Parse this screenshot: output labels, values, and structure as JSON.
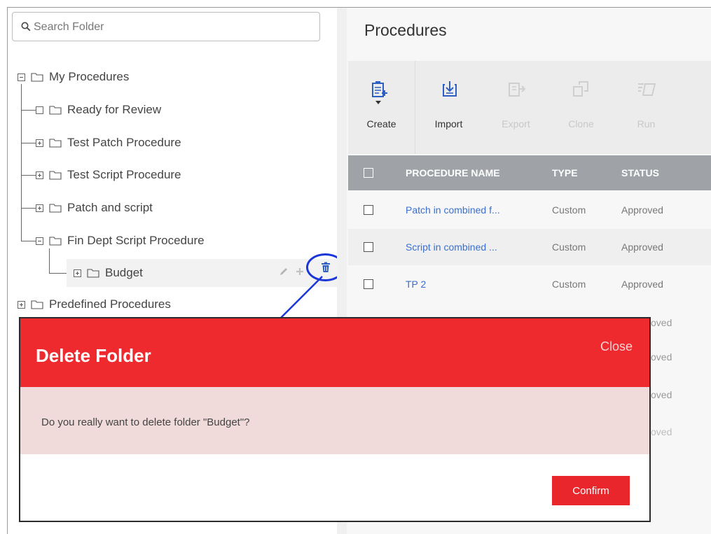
{
  "left_panel": {
    "search_placeholder": "Search Folder",
    "tree": [
      {
        "label": "My Procedures",
        "toggle": "minus"
      },
      {
        "label": "Ready for Review",
        "toggle": "none"
      },
      {
        "label": "Test Patch Procedure",
        "toggle": "plus"
      },
      {
        "label": "Test Script Procedure",
        "toggle": "plus"
      },
      {
        "label": "Patch and script",
        "toggle": "plus"
      },
      {
        "label": "Fin Dept Script Procedure",
        "toggle": "minus"
      },
      {
        "label": "Budget",
        "toggle": "plus"
      },
      {
        "label": "Predefined Procedures",
        "toggle": "plus"
      }
    ]
  },
  "right_panel": {
    "title": "Procedures",
    "toolbar": [
      {
        "label": "Create",
        "icon": "create-icon",
        "enabled": true
      },
      {
        "label": "Import",
        "icon": "import-icon",
        "enabled": true
      },
      {
        "label": "Export",
        "icon": "export-icon",
        "enabled": false
      },
      {
        "label": "Clone",
        "icon": "clone-icon",
        "enabled": false
      },
      {
        "label": "Run",
        "icon": "run-icon",
        "enabled": false
      }
    ],
    "table": {
      "columns": [
        "PROCEDURE NAME",
        "TYPE",
        "STATUS"
      ],
      "rows": [
        {
          "name": "Patch in combined f...",
          "type": "Custom",
          "status": "Approved"
        },
        {
          "name": "Script in combined ...",
          "type": "Custom",
          "status": "Approved"
        },
        {
          "name": "TP 2",
          "type": "Custom",
          "status": "Approved"
        }
      ]
    },
    "partial_status": "oved"
  },
  "modal": {
    "title": "Delete Folder",
    "close_label": "Close",
    "message": "Do you really want to delete folder \"Budget\"?",
    "confirm_label": "Confirm"
  },
  "colors": {
    "accent_red": "#ee2a2f",
    "link_blue": "#3a6fd0",
    "annotation_blue": "#1a35d8"
  }
}
